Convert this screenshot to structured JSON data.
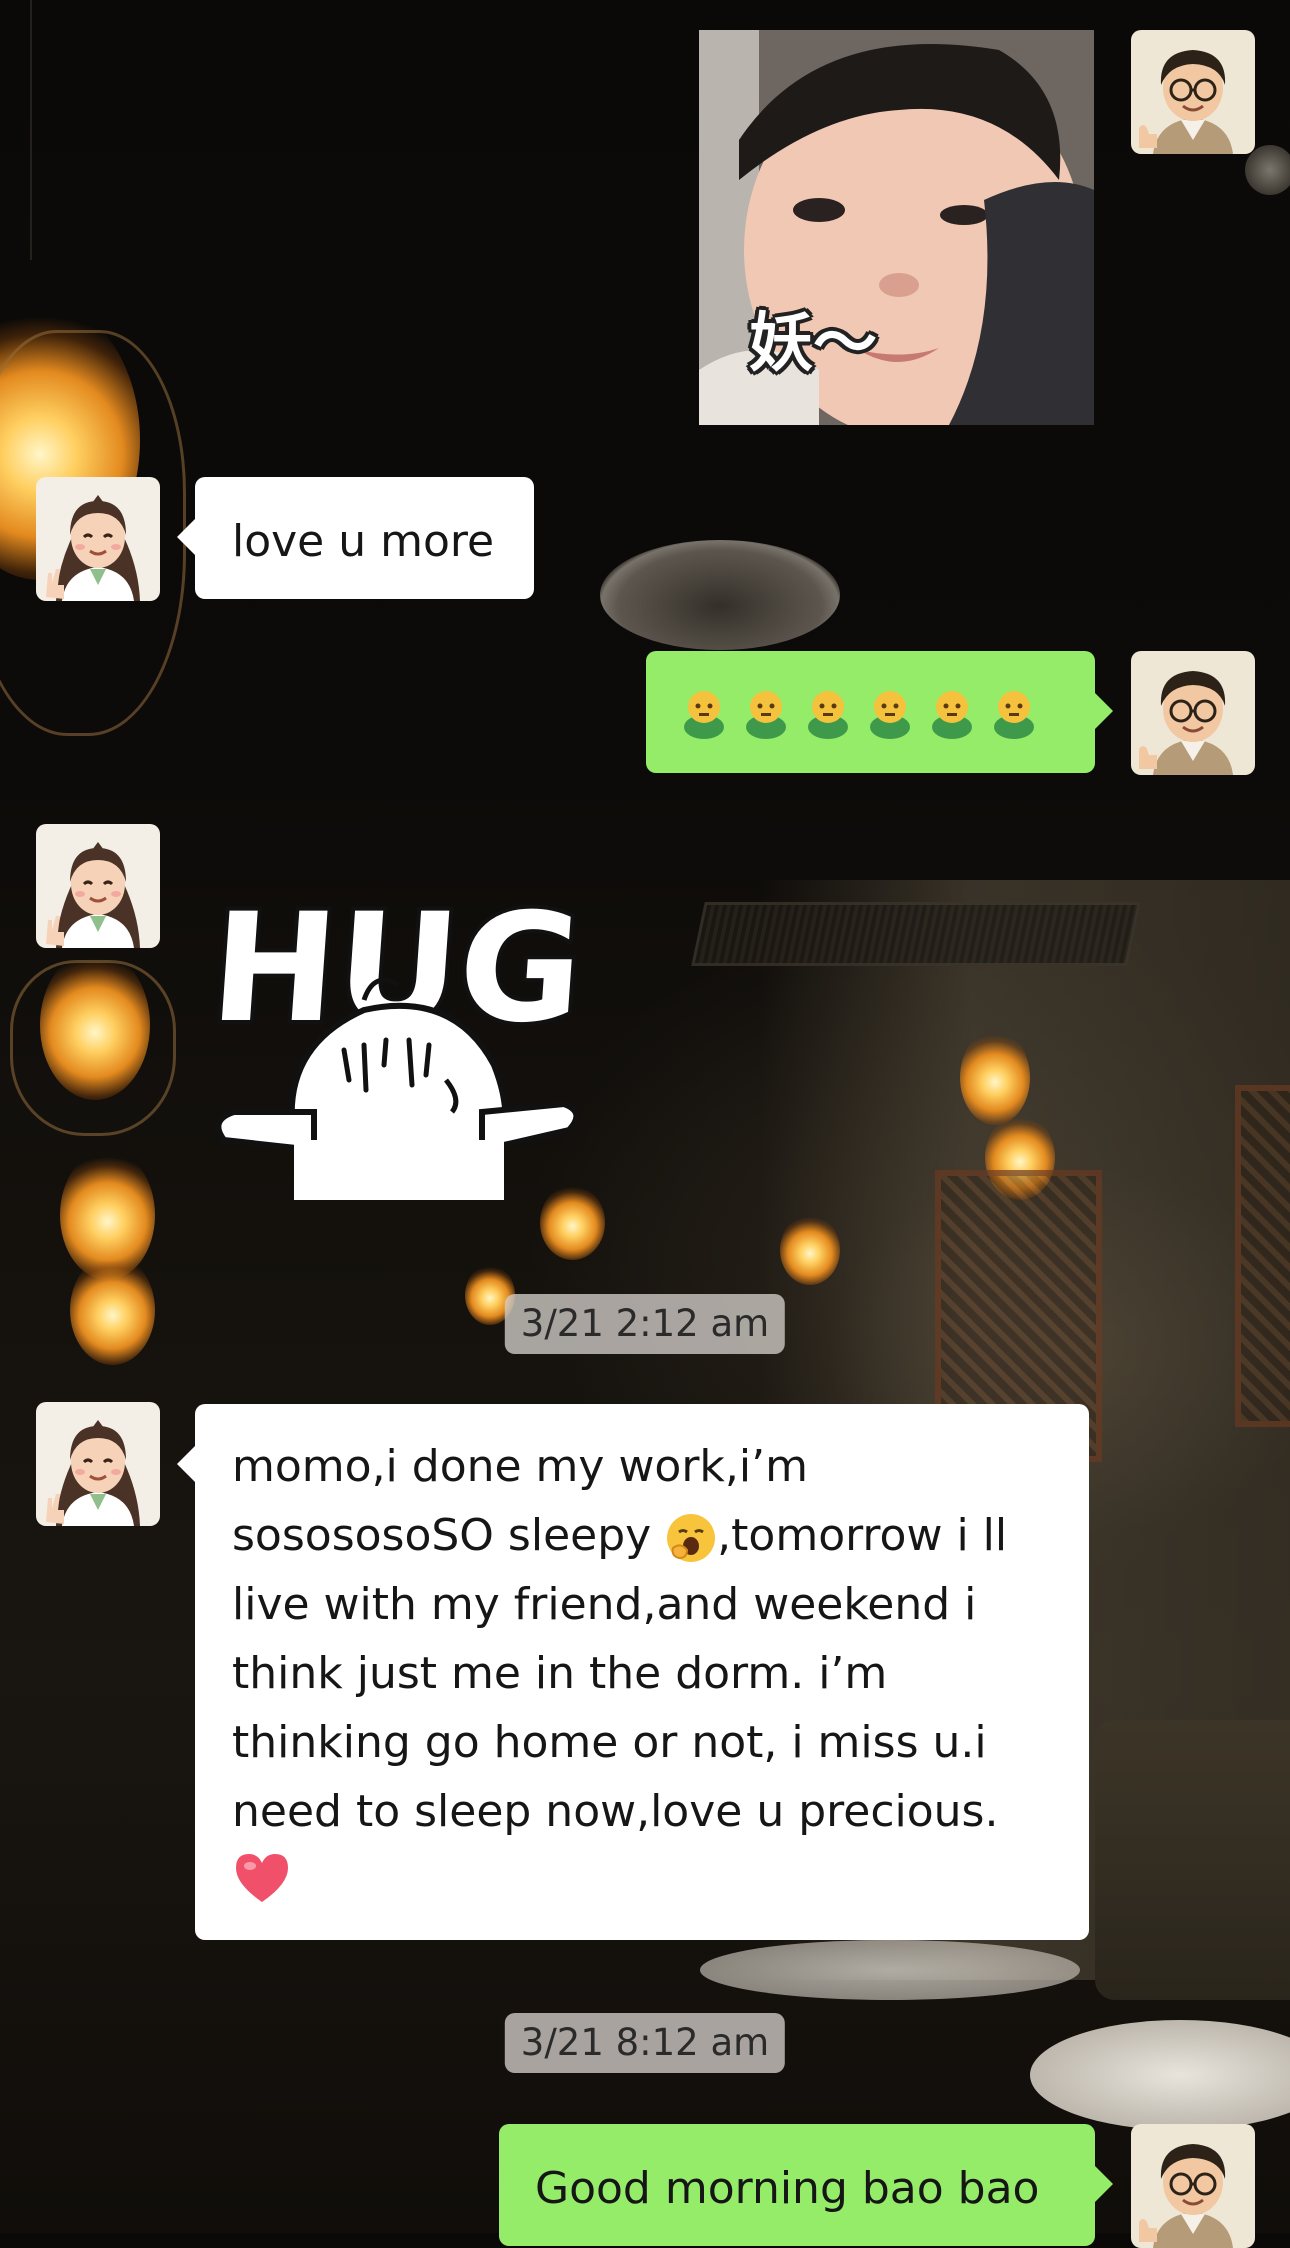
{
  "messages": [
    {
      "side": "right",
      "type": "sticker",
      "sticker": "baby-face-photo",
      "caption": "妖～"
    },
    {
      "side": "left",
      "type": "text",
      "text": "love u more"
    },
    {
      "side": "right",
      "type": "emoji",
      "emoji": "green-figure-emoji",
      "count": 6
    },
    {
      "side": "left",
      "type": "sticker",
      "sticker": "hug-sticker",
      "caption": "HUG"
    },
    {
      "type": "timestamp",
      "text": "3/21 2:12 am"
    },
    {
      "side": "left",
      "type": "text",
      "text_before_emoji": "momo,i done my work,i’m\nsosososoSO sleepy ",
      "emoji": "yawning-face-emoji",
      "text_after_emoji": ",tomorrow i ll\nlive with my friend,and weekend i\nthink just me in the dorm. i’m\nthinking go home or not, i miss u.i\nneed to sleep now,love u precious.",
      "trailing_emoji": "red-heart-emoji"
    },
    {
      "type": "timestamp",
      "text": "3/21 8:12 am"
    },
    {
      "side": "right",
      "type": "text",
      "text": "Good morning bao bao"
    }
  ],
  "avatars": {
    "self": "male-cartoon-avatar",
    "contact": "female-cartoon-avatar"
  },
  "colors": {
    "sent_bubble": "#95ec69",
    "received_bubble": "#ffffff",
    "timestamp_bg": "#d2cdc8"
  }
}
